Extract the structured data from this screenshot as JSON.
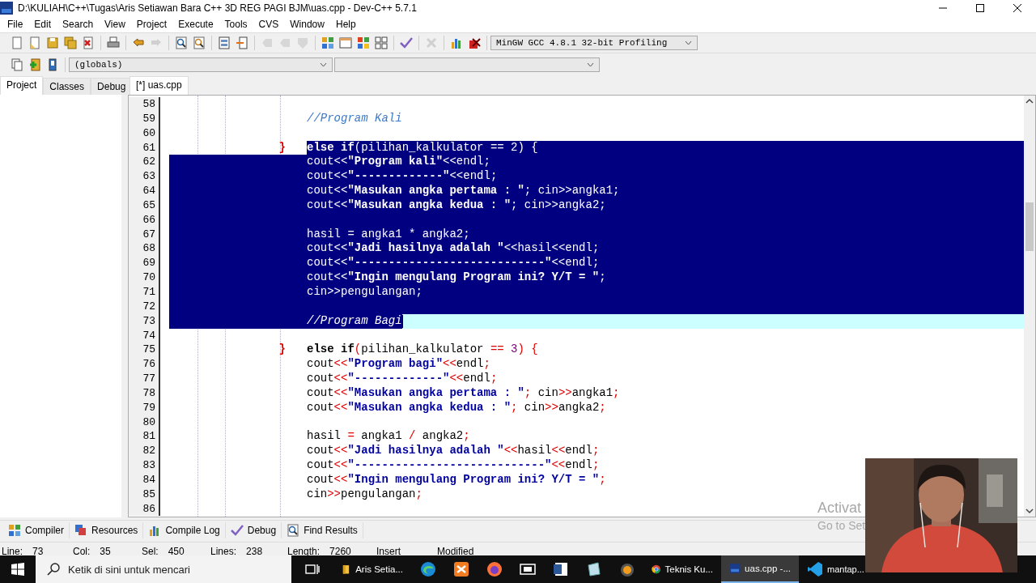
{
  "window": {
    "title": "D:\\KULIAH\\C++\\Tugas\\Aris Setiawan Bara C++ 3D REG PAGI BJM\\uas.cpp - Dev-C++ 5.7.1"
  },
  "menu": [
    "File",
    "Edit",
    "Search",
    "View",
    "Project",
    "Execute",
    "Tools",
    "CVS",
    "Window",
    "Help"
  ],
  "toolbar": {
    "buttons": [
      {
        "disabled": false
      },
      {
        "disabled": false
      },
      {
        "disabled": false
      },
      {
        "disabled": false
      },
      {
        "disabled": false
      },
      {
        "disabled": false
      },
      {
        "disabled": false
      },
      {
        "disabled": true
      },
      {
        "disabled": false
      },
      {
        "disabled": false
      },
      {
        "disabled": false
      },
      {
        "disabled": false
      },
      {
        "disabled": true
      },
      {
        "disabled": true
      },
      {
        "disabled": true
      },
      {
        "disabled": false
      },
      {
        "disabled": false
      },
      {
        "disabled": false
      },
      {
        "disabled": false
      },
      {
        "disabled": false
      },
      {
        "disabled": true
      },
      {
        "disabled": false
      },
      {
        "disabled": false
      }
    ],
    "compiler": "MinGW GCC 4.8.1 32-bit Profiling"
  },
  "toolbar_2": {
    "buttons": [
      {
        "disabled": false
      },
      {
        "disabled": false
      },
      {
        "disabled": false
      }
    ],
    "scope": "(globals)"
  },
  "side_tabs": [
    {
      "label": "Project",
      "selected": true
    },
    {
      "label": "Classes",
      "selected": false
    },
    {
      "label": "Debug",
      "selected": false
    }
  ],
  "editor_tabs": [
    {
      "label": "[*] uas.cpp",
      "selected": true
    }
  ],
  "editor": {
    "lines": [
      {
        "number": "58",
        "selected": false,
        "current": false
      },
      {
        "number": "59",
        "selected": false,
        "current": false,
        "code": [
          {
            "kind": "comment",
            "text": "//Program Kali"
          }
        ]
      },
      {
        "number": "60",
        "selected": false,
        "current": false
      },
      {
        "number": "61",
        "selected": true,
        "current": false,
        "brace": "}",
        "code": [
          {
            "kind": "keyword",
            "text": "else"
          },
          {
            "kind": "keyword",
            "text": " if"
          },
          {
            "kind": "symbol",
            "text": "("
          },
          {
            "kind": "plain",
            "text": "pilihan_kalkulator "
          },
          {
            "kind": "symbol",
            "text": "=="
          },
          {
            "kind": "number",
            "text": " 2"
          },
          {
            "kind": "symbol",
            "text": ")"
          },
          {
            "kind": "symbol",
            "text": " {"
          }
        ]
      },
      {
        "number": "62",
        "selected": true,
        "current": false,
        "code": [
          {
            "kind": "plain",
            "text": "cout"
          },
          {
            "kind": "symbol",
            "text": "<<"
          },
          {
            "kind": "string",
            "text": "\"Program kali\""
          },
          {
            "kind": "symbol",
            "text": "<<"
          },
          {
            "kind": "plain",
            "text": "endl"
          },
          {
            "kind": "symbol",
            "text": ";"
          }
        ]
      },
      {
        "number": "63",
        "selected": true,
        "current": false,
        "code": [
          {
            "kind": "plain",
            "text": "cout"
          },
          {
            "kind": "symbol",
            "text": "<<"
          },
          {
            "kind": "string",
            "text": "\"-------------\""
          },
          {
            "kind": "symbol",
            "text": "<<"
          },
          {
            "kind": "plain",
            "text": "endl"
          },
          {
            "kind": "symbol",
            "text": ";"
          }
        ]
      },
      {
        "number": "64",
        "selected": true,
        "current": false,
        "code": [
          {
            "kind": "plain",
            "text": "cout"
          },
          {
            "kind": "symbol",
            "text": "<<"
          },
          {
            "kind": "string",
            "text": "\"Masukan angka pertama : \""
          },
          {
            "kind": "symbol",
            "text": ";"
          },
          {
            "kind": "plain",
            "text": " cin"
          },
          {
            "kind": "symbol",
            "text": ">>"
          },
          {
            "kind": "plain",
            "text": "angka1"
          },
          {
            "kind": "symbol",
            "text": ";"
          }
        ]
      },
      {
        "number": "65",
        "selected": true,
        "current": false,
        "code": [
          {
            "kind": "plain",
            "text": "cout"
          },
          {
            "kind": "symbol",
            "text": "<<"
          },
          {
            "kind": "string",
            "text": "\"Masukan angka kedua : \""
          },
          {
            "kind": "symbol",
            "text": ";"
          },
          {
            "kind": "plain",
            "text": " cin"
          },
          {
            "kind": "symbol",
            "text": ">>"
          },
          {
            "kind": "plain",
            "text": "angka2"
          },
          {
            "kind": "symbol",
            "text": ";"
          }
        ]
      },
      {
        "number": "66",
        "selected": true,
        "current": false
      },
      {
        "number": "67",
        "selected": true,
        "current": false,
        "code": [
          {
            "kind": "plain",
            "text": "hasil "
          },
          {
            "kind": "symbol",
            "text": "="
          },
          {
            "kind": "plain",
            "text": " angka1 "
          },
          {
            "kind": "symbol",
            "text": "*"
          },
          {
            "kind": "plain",
            "text": " angka2"
          },
          {
            "kind": "symbol",
            "text": ";"
          }
        ]
      },
      {
        "number": "68",
        "selected": true,
        "current": false,
        "code": [
          {
            "kind": "plain",
            "text": "cout"
          },
          {
            "kind": "symbol",
            "text": "<<"
          },
          {
            "kind": "string",
            "text": "\"Jadi hasilnya adalah \""
          },
          {
            "kind": "symbol",
            "text": "<<"
          },
          {
            "kind": "plain",
            "text": "hasil"
          },
          {
            "kind": "symbol",
            "text": "<<"
          },
          {
            "kind": "plain",
            "text": "endl"
          },
          {
            "kind": "symbol",
            "text": ";"
          }
        ]
      },
      {
        "number": "69",
        "selected": true,
        "current": false,
        "code": [
          {
            "kind": "plain",
            "text": "cout"
          },
          {
            "kind": "symbol",
            "text": "<<"
          },
          {
            "kind": "string",
            "text": "\"----------------------------\""
          },
          {
            "kind": "symbol",
            "text": "<<"
          },
          {
            "kind": "plain",
            "text": "endl"
          },
          {
            "kind": "symbol",
            "text": ";"
          }
        ]
      },
      {
        "number": "70",
        "selected": true,
        "current": false,
        "code": [
          {
            "kind": "plain",
            "text": "cout"
          },
          {
            "kind": "symbol",
            "text": "<<"
          },
          {
            "kind": "string",
            "text": "\"Ingin mengulang Program ini? Y/T = \""
          },
          {
            "kind": "symbol",
            "text": ";"
          }
        ]
      },
      {
        "number": "71",
        "selected": true,
        "current": false,
        "code": [
          {
            "kind": "plain",
            "text": "cin"
          },
          {
            "kind": "symbol",
            "text": ">>"
          },
          {
            "kind": "plain",
            "text": "pengulangan"
          },
          {
            "kind": "symbol",
            "text": ";"
          }
        ]
      },
      {
        "number": "72",
        "selected": true,
        "current": false
      },
      {
        "number": "73",
        "selected": true,
        "current": true,
        "code": [
          {
            "kind": "comment",
            "text": "//Program Bagi"
          }
        ]
      },
      {
        "number": "74",
        "selected": false,
        "current": false
      },
      {
        "number": "75",
        "selected": false,
        "current": false,
        "brace": "}",
        "code": [
          {
            "kind": "keyword",
            "text": "else"
          },
          {
            "kind": "keyword",
            "text": " if"
          },
          {
            "kind": "symbol",
            "text": "("
          },
          {
            "kind": "plain",
            "text": "pilihan_kalkulator "
          },
          {
            "kind": "symbol",
            "text": "=="
          },
          {
            "kind": "number",
            "text": " 3"
          },
          {
            "kind": "symbol",
            "text": ")"
          },
          {
            "kind": "symbol",
            "text": " {"
          }
        ]
      },
      {
        "number": "76",
        "selected": false,
        "current": false,
        "code": [
          {
            "kind": "plain",
            "text": "cout"
          },
          {
            "kind": "symbol",
            "text": "<<"
          },
          {
            "kind": "string",
            "text": "\"Program bagi\""
          },
          {
            "kind": "symbol",
            "text": "<<"
          },
          {
            "kind": "plain",
            "text": "endl"
          },
          {
            "kind": "symbol",
            "text": ";"
          }
        ]
      },
      {
        "number": "77",
        "selected": false,
        "current": false,
        "code": [
          {
            "kind": "plain",
            "text": "cout"
          },
          {
            "kind": "symbol",
            "text": "<<"
          },
          {
            "kind": "string",
            "text": "\"-------------\""
          },
          {
            "kind": "symbol",
            "text": "<<"
          },
          {
            "kind": "plain",
            "text": "endl"
          },
          {
            "kind": "symbol",
            "text": ";"
          }
        ]
      },
      {
        "number": "78",
        "selected": false,
        "current": false,
        "code": [
          {
            "kind": "plain",
            "text": "cout"
          },
          {
            "kind": "symbol",
            "text": "<<"
          },
          {
            "kind": "string",
            "text": "\"Masukan angka pertama : \""
          },
          {
            "kind": "symbol",
            "text": ";"
          },
          {
            "kind": "plain",
            "text": " cin"
          },
          {
            "kind": "symbol",
            "text": ">>"
          },
          {
            "kind": "plain",
            "text": "angka1"
          },
          {
            "kind": "symbol",
            "text": ";"
          }
        ]
      },
      {
        "number": "79",
        "selected": false,
        "current": false,
        "code": [
          {
            "kind": "plain",
            "text": "cout"
          },
          {
            "kind": "symbol",
            "text": "<<"
          },
          {
            "kind": "string",
            "text": "\"Masukan angka kedua : \""
          },
          {
            "kind": "symbol",
            "text": ";"
          },
          {
            "kind": "plain",
            "text": " cin"
          },
          {
            "kind": "symbol",
            "text": ">>"
          },
          {
            "kind": "plain",
            "text": "angka2"
          },
          {
            "kind": "symbol",
            "text": ";"
          }
        ]
      },
      {
        "number": "80",
        "selected": false,
        "current": false
      },
      {
        "number": "81",
        "selected": false,
        "current": false,
        "code": [
          {
            "kind": "plain",
            "text": "hasil "
          },
          {
            "kind": "symbol",
            "text": "="
          },
          {
            "kind": "plain",
            "text": " angka1 "
          },
          {
            "kind": "symbol",
            "text": "/"
          },
          {
            "kind": "plain",
            "text": " angka2"
          },
          {
            "kind": "symbol",
            "text": ";"
          }
        ]
      },
      {
        "number": "82",
        "selected": false,
        "current": false,
        "code": [
          {
            "kind": "plain",
            "text": "cout"
          },
          {
            "kind": "symbol",
            "text": "<<"
          },
          {
            "kind": "string",
            "text": "\"Jadi hasilnya adalah \""
          },
          {
            "kind": "symbol",
            "text": "<<"
          },
          {
            "kind": "plain",
            "text": "hasil"
          },
          {
            "kind": "symbol",
            "text": "<<"
          },
          {
            "kind": "plain",
            "text": "endl"
          },
          {
            "kind": "symbol",
            "text": ";"
          }
        ]
      },
      {
        "number": "83",
        "selected": false,
        "current": false,
        "code": [
          {
            "kind": "plain",
            "text": "cout"
          },
          {
            "kind": "symbol",
            "text": "<<"
          },
          {
            "kind": "string",
            "text": "\"----------------------------\""
          },
          {
            "kind": "symbol",
            "text": "<<"
          },
          {
            "kind": "plain",
            "text": "endl"
          },
          {
            "kind": "symbol",
            "text": ";"
          }
        ]
      },
      {
        "number": "84",
        "selected": false,
        "current": false,
        "code": [
          {
            "kind": "plain",
            "text": "cout"
          },
          {
            "kind": "symbol",
            "text": "<<"
          },
          {
            "kind": "string",
            "text": "\"Ingin mengulang Program ini? Y/T = \""
          },
          {
            "kind": "symbol",
            "text": ";"
          }
        ]
      },
      {
        "number": "85",
        "selected": false,
        "current": false,
        "code": [
          {
            "kind": "plain",
            "text": "cin"
          },
          {
            "kind": "symbol",
            "text": ">>"
          },
          {
            "kind": "plain",
            "text": "pengulangan"
          },
          {
            "kind": "symbol",
            "text": ";"
          }
        ]
      },
      {
        "number": "86",
        "selected": false,
        "current": false
      }
    ]
  },
  "activation_notice": {
    "title": "Activat",
    "subtitle": "Go to Set"
  },
  "bottom_tabs": [
    "Compiler",
    "Resources",
    "Compile Log",
    "Debug",
    "Find Results"
  ],
  "status_bar": [
    {
      "label": "Line:",
      "value": "73"
    },
    {
      "label": "Col:",
      "value": "35"
    },
    {
      "label": "Sel:",
      "value": "450"
    },
    {
      "label": "Lines:",
      "value": "238"
    },
    {
      "label": "Length:",
      "value": "7260"
    },
    {
      "value": "Insert"
    },
    {
      "value": "Modified"
    }
  ],
  "taskbar": {
    "search": {
      "placeholder": "Ketik di sini untuk mencari"
    },
    "apps": [
      {
        "label": "Aris Setia...",
        "selected": false
      },
      {
        "selected": false
      },
      {
        "selected": false
      },
      {
        "selected": false
      },
      {
        "selected": false
      },
      {
        "selected": false
      },
      {
        "selected": false
      },
      {
        "selected": false
      },
      {
        "label": "Teknis Ku...",
        "selected": false
      },
      {
        "label": "uas.cpp -...",
        "selected": true
      },
      {
        "label": "mantap...",
        "selected": false
      }
    ]
  },
  "webcam": {
    "kind": "picture"
  }
}
